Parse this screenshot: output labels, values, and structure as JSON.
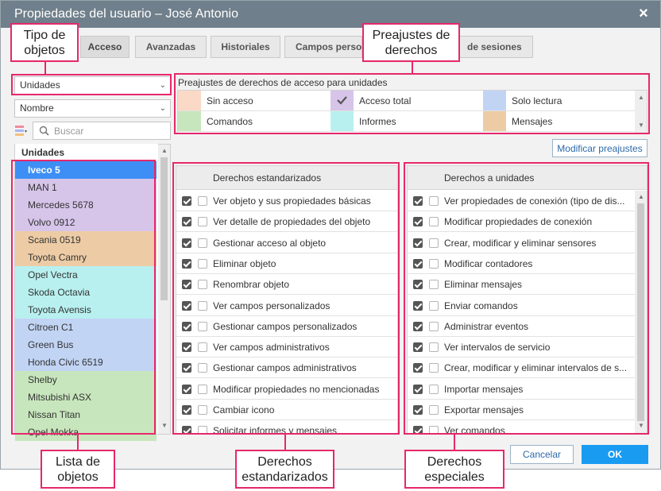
{
  "dialog": {
    "title": "Propiedades del usuario – José Antonio",
    "close_glyph": "×"
  },
  "tabs": [
    {
      "label": "Acceso"
    },
    {
      "label": "Avanzadas"
    },
    {
      "label": "Historiales"
    },
    {
      "label": "Campos perso"
    },
    {
      "label": "de sesiones"
    }
  ],
  "left": {
    "object_type": "Unidades",
    "sort_by": "Nombre",
    "search_placeholder": "Buscar",
    "list_header": "Unidades",
    "items": [
      {
        "name": "Iveco 5",
        "color": "#3d8ff5",
        "selected": true
      },
      {
        "name": "MAN 1",
        "color": "#d6c4e9"
      },
      {
        "name": "Mercedes 5678",
        "color": "#d6c4e9"
      },
      {
        "name": "Volvo 0912",
        "color": "#d6c4e9"
      },
      {
        "name": "Scania 0519",
        "color": "#edcca5"
      },
      {
        "name": "Toyota Camry",
        "color": "#edcca5"
      },
      {
        "name": "Opel Vectra",
        "color": "#b8f0ef"
      },
      {
        "name": "Skoda Octavia",
        "color": "#b8f0ef"
      },
      {
        "name": "Toyota Avensis",
        "color": "#b8f0ef"
      },
      {
        "name": "Citroen C1",
        "color": "#c2d4f4"
      },
      {
        "name": "Green Bus",
        "color": "#c2d4f4"
      },
      {
        "name": "Honda Civic 6519",
        "color": "#c2d4f4"
      },
      {
        "name": "Shelby",
        "color": "#c8e6bd"
      },
      {
        "name": "Mitsubishi ASX",
        "color": "#c8e6bd"
      },
      {
        "name": "Nissan Titan",
        "color": "#c8e6bd"
      },
      {
        "name": "Opel Mokka",
        "color": "#c8e6bd"
      }
    ]
  },
  "presets": {
    "title": "Preajustes de derechos de acceso para unidades",
    "items": [
      {
        "label": "Sin acceso",
        "color": "#fad9c6"
      },
      {
        "label": "Acceso total",
        "color": "#d6c4e9",
        "checked": true
      },
      {
        "label": "Solo lectura",
        "color": "#c2d4f4"
      },
      {
        "label": "Comandos",
        "color": "#c8e6bd"
      },
      {
        "label": "Informes",
        "color": "#b8f0ef"
      },
      {
        "label": "Mensajes",
        "color": "#edcca5"
      }
    ],
    "modify_button": "Modificar preajustes"
  },
  "standard_rights": {
    "header": "Derechos estandarizados",
    "rows": [
      {
        "label": "Ver objeto y sus propiedades básicas",
        "checked": true
      },
      {
        "label": "Ver detalle de propiedades del objeto",
        "checked": true
      },
      {
        "label": "Gestionar acceso al objeto",
        "checked": true
      },
      {
        "label": "Eliminar objeto",
        "checked": true
      },
      {
        "label": "Renombrar objeto",
        "checked": true
      },
      {
        "label": "Ver campos personalizados",
        "checked": true
      },
      {
        "label": "Gestionar campos personalizados",
        "checked": true
      },
      {
        "label": "Ver campos administrativos",
        "checked": true
      },
      {
        "label": "Gestionar campos administrativos",
        "checked": true
      },
      {
        "label": "Modificar propiedades no mencionadas",
        "checked": true
      },
      {
        "label": "Cambiar icono",
        "checked": true
      },
      {
        "label": "Solicitar informes y mensajes",
        "checked": true
      }
    ]
  },
  "unit_rights": {
    "header": "Derechos a unidades",
    "rows": [
      {
        "label": "Ver propiedades de conexión (tipo de dis...",
        "checked": true
      },
      {
        "label": "Modificar propiedades de conexión",
        "checked": true
      },
      {
        "label": "Crear, modificar y eliminar sensores",
        "checked": true
      },
      {
        "label": "Modificar contadores",
        "checked": true
      },
      {
        "label": "Eliminar mensajes",
        "checked": true
      },
      {
        "label": "Enviar comandos",
        "checked": true
      },
      {
        "label": "Administrar eventos",
        "checked": true
      },
      {
        "label": "Ver intervalos de servicio",
        "checked": true
      },
      {
        "label": "Crear, modificar y eliminar intervalos de s...",
        "checked": true
      },
      {
        "label": "Importar mensajes",
        "checked": true
      },
      {
        "label": "Exportar mensajes",
        "checked": true
      },
      {
        "label": "Ver comandos",
        "checked": true
      }
    ]
  },
  "footer": {
    "cancel": "Cancelar",
    "ok": "OK"
  },
  "callouts": {
    "object_type": "Tipo de objetos",
    "rights_presets": "Preajustes de derechos",
    "object_list": "Lista de objetos",
    "standard_rights": "Derechos estandarizados",
    "special_rights": "Derechos especiales"
  }
}
